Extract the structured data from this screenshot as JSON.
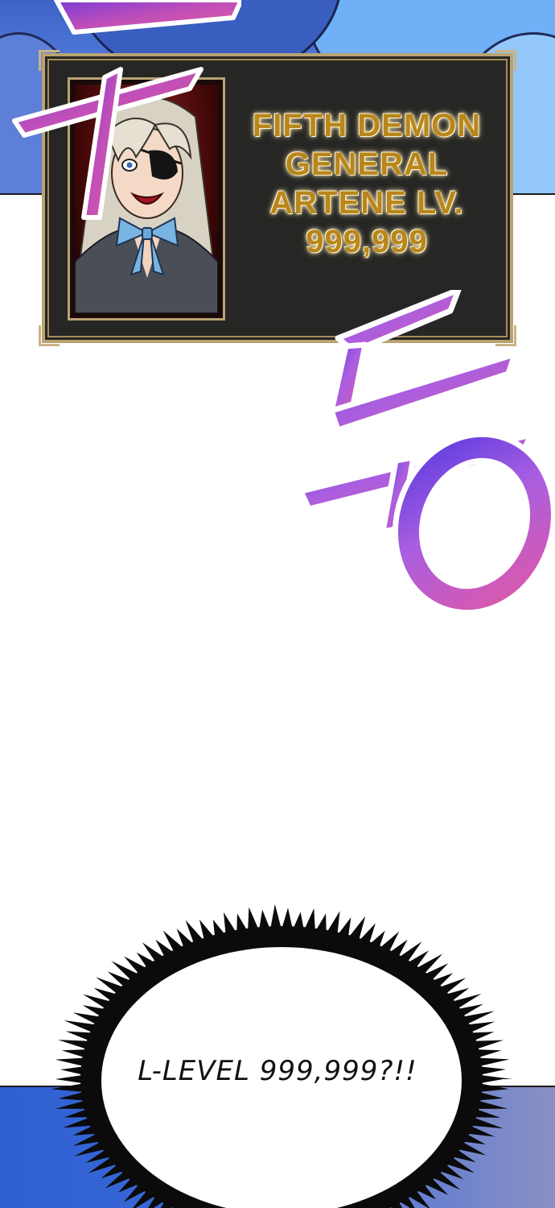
{
  "status_window": {
    "title": "FIFTH DEMON\nGENERAL\nARTENE LV.\n999,999"
  },
  "speech_bubble": {
    "text": "L-LEVEL 999,999?!!"
  },
  "colors": {
    "status_text": "#b8861b",
    "frame_gold": "#b9a372",
    "window_bg": "#262624",
    "sfx_purple": "#8a4fe0",
    "sfx_pink": "#e05aa8"
  },
  "icons": {
    "sfx_top": "sfx-stroke-glyph",
    "sfx_right": "sfx-duung-glyph"
  }
}
